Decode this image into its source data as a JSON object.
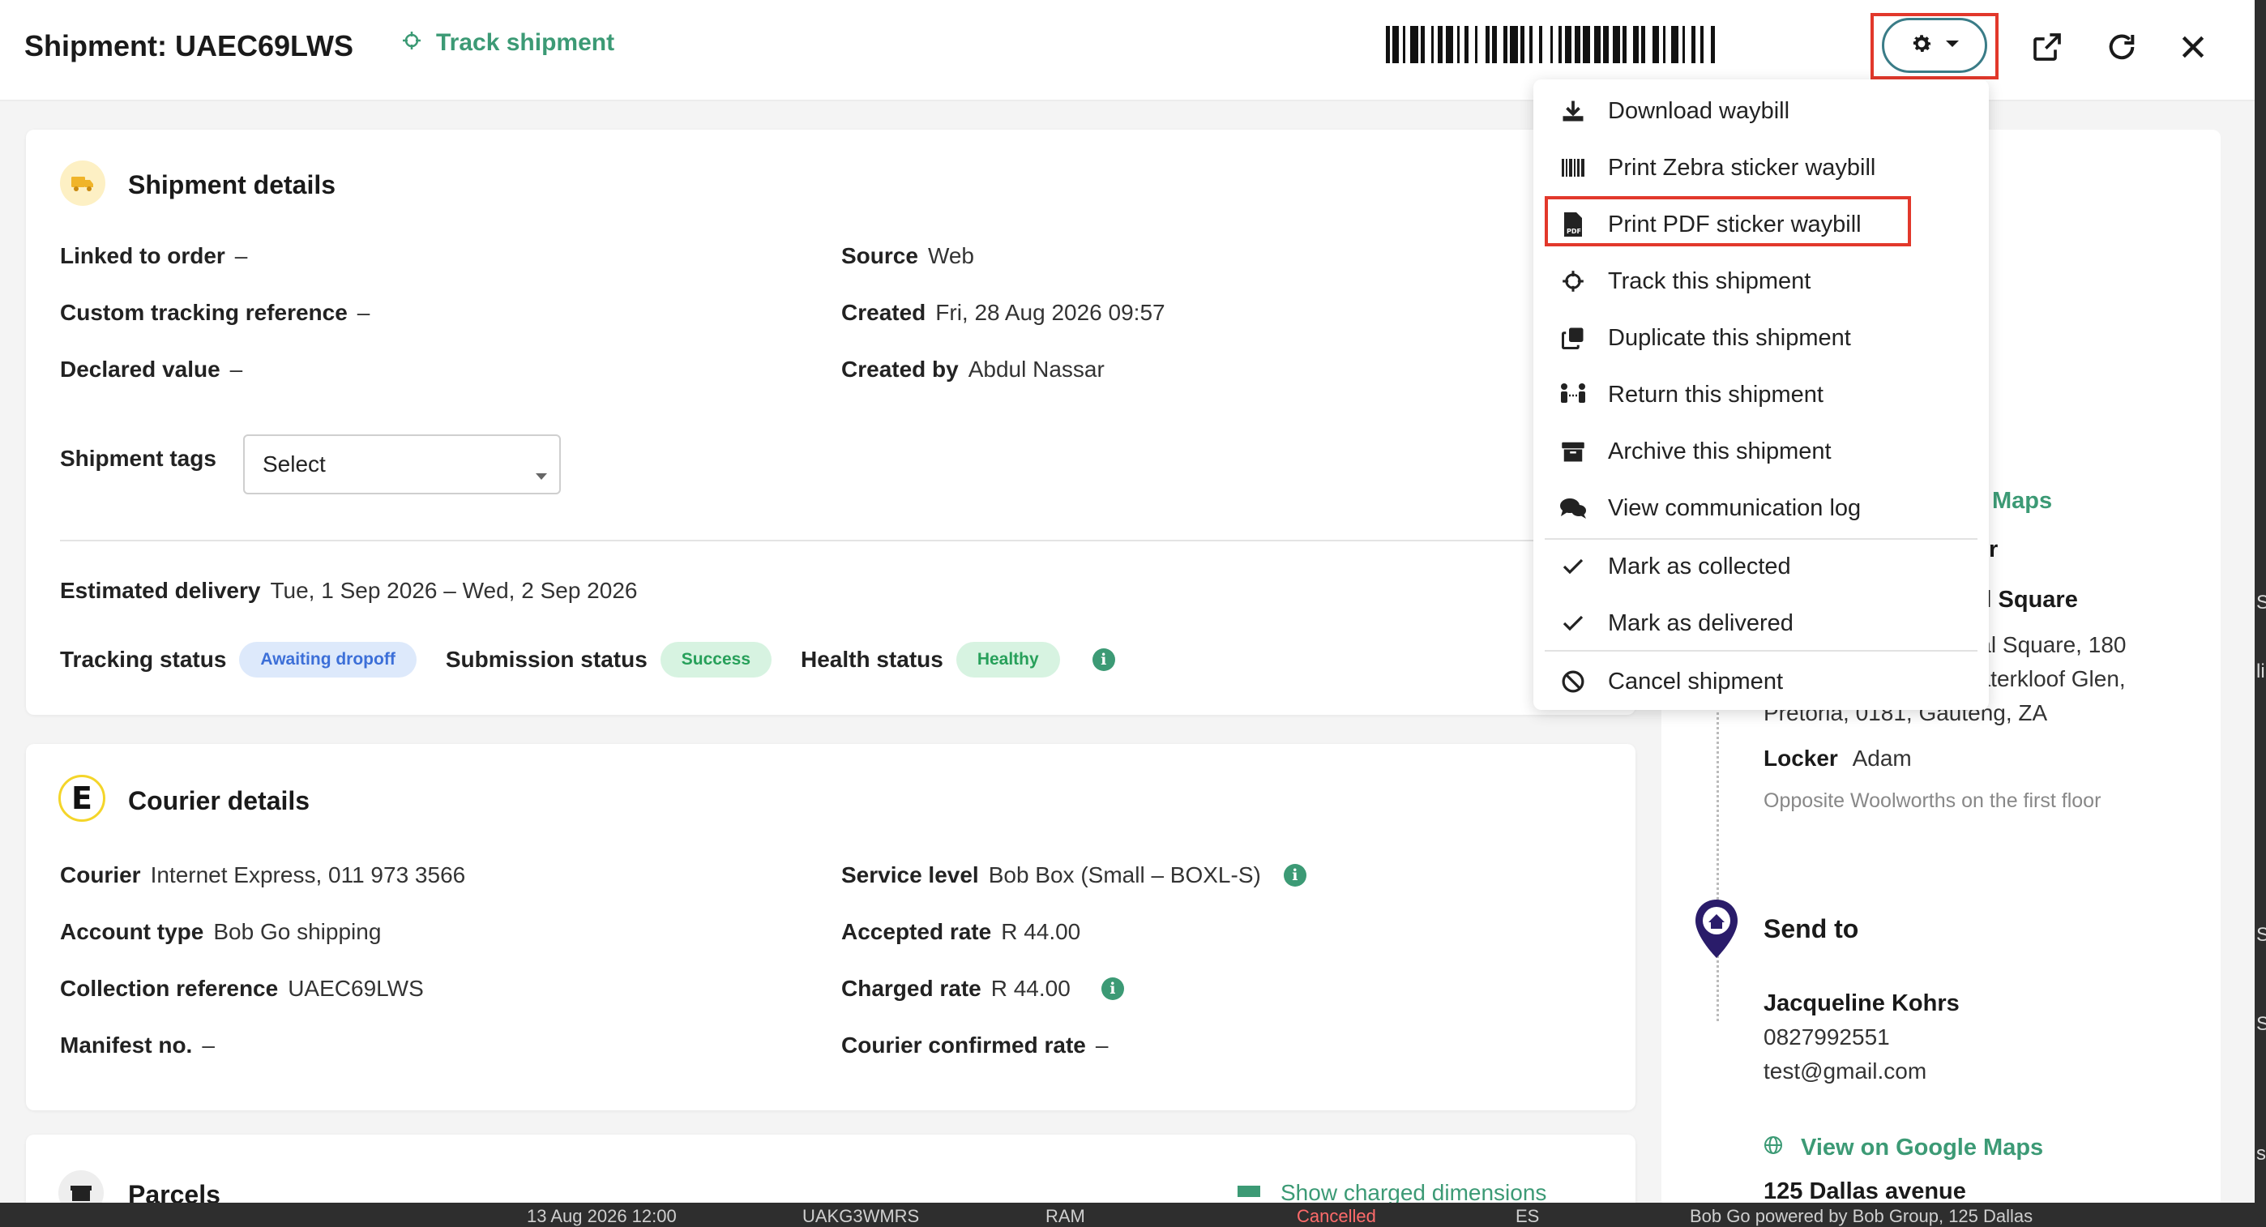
{
  "header": {
    "title": "Shipment: UAEC69LWS",
    "track_label": "Track shipment"
  },
  "icons": {
    "track": "crosshair-icon",
    "settings": "gear-icon",
    "caret": "caret-down-icon",
    "open_external": "external-link-icon",
    "refresh": "refresh-icon",
    "close": "close-icon"
  },
  "shipment_details": {
    "title": "Shipment details",
    "linked_to_order_label": "Linked to order",
    "linked_to_order_value": "–",
    "custom_tracking_label": "Custom tracking reference",
    "custom_tracking_value": "–",
    "declared_value_label": "Declared value",
    "declared_value_value": "–",
    "source_label": "Source",
    "source_value": "Web",
    "created_label": "Created",
    "created_value": "Fri, 28 Aug 2026 09:57",
    "created_by_label": "Created by",
    "created_by_value": "Abdul Nassar",
    "tags_label": "Shipment tags",
    "tags_select_value": "Select",
    "estimated_delivery_label": "Estimated delivery",
    "estimated_delivery_value": "Tue, 1 Sep 2026 – Wed, 2 Sep 2026",
    "tracking_status_label": "Tracking status",
    "tracking_status_value": "Awaiting dropoff",
    "submission_status_label": "Submission status",
    "submission_status_value": "Success",
    "health_status_label": "Health status",
    "health_status_value": "Healthy"
  },
  "courier_details": {
    "title": "Courier details",
    "logo_letter": "E",
    "courier_label": "Courier",
    "courier_value": "Internet Express, 011 973 3566",
    "account_type_label": "Account type",
    "account_type_value": "Bob Go shipping",
    "collection_ref_label": "Collection reference",
    "collection_ref_value": "UAEC69LWS",
    "manifest_label": "Manifest no.",
    "manifest_value": "–",
    "service_level_label": "Service level",
    "service_level_value": "Bob Box (Small – BOXL-S)",
    "accepted_rate_label": "Accepted rate",
    "accepted_rate_value": "R 44.00",
    "charged_rate_label": "Charged rate",
    "charged_rate_value": "R 44.00",
    "courier_confirmed_rate_label": "Courier confirmed rate",
    "courier_confirmed_rate_value": "–"
  },
  "parcels": {
    "title": "Parcels",
    "show_charged_label": "Show charged dimensions"
  },
  "settings_menu": {
    "items": [
      {
        "label": "Download waybill",
        "icon": "download-icon"
      },
      {
        "label": "Print Zebra sticker waybill",
        "icon": "barcode-icon"
      },
      {
        "label": "Print PDF sticker waybill",
        "icon": "pdf-file-icon"
      },
      {
        "label": "Track this shipment",
        "icon": "crosshair-icon"
      },
      {
        "label": "Duplicate this shipment",
        "icon": "copy-icon"
      },
      {
        "label": "Return this shipment",
        "icon": "return-people-icon"
      },
      {
        "label": "Archive this shipment",
        "icon": "archive-icon"
      },
      {
        "label": "View communication log",
        "icon": "chat-icon"
      },
      {
        "label": "Mark as collected",
        "icon": "check-icon"
      },
      {
        "label": "Mark as delivered",
        "icon": "check-icon"
      },
      {
        "label": "Cancel shipment",
        "icon": "ban-icon"
      }
    ]
  },
  "collect_from": {
    "maps_link_partial": "Maps",
    "name_partial_1": "r",
    "name_partial_2": "ral Square",
    "address_line1_partial": "ral Square, 180",
    "address_line2_partial": "Vaterkloof Glen,",
    "address_line3": "Pretoria, 0181, Gauteng, ZA",
    "locker_label": "Locker",
    "locker_value": "Adam",
    "note": "Opposite Woolworths on the first floor"
  },
  "send_to": {
    "title": "Send to",
    "name": "Jacqueline Kohrs",
    "phone": "0827992551",
    "email": "test@gmail.com",
    "maps_link": "View on Google Maps",
    "address_line1": "125 Dallas avenue"
  },
  "background_page": {
    "strip_items": [
      "13 Aug 2026 12:00",
      "UAKG3WMRS",
      "RAM",
      "Cancelled",
      "ES",
      "Bob Go powered by Bob Group, 125 Dallas"
    ],
    "right_glyphs": [
      "S",
      "li",
      "S",
      "S",
      "s"
    ]
  },
  "colors": {
    "accent_green": "#3c9a75",
    "highlight_red": "#e2382b",
    "gear_border": "#3a7c87",
    "pill_blue_bg": "#dde9fb",
    "pill_blue_text": "#3c6fd8",
    "pill_green_bg": "#d7f3e1",
    "pill_green_text": "#27a05a"
  }
}
